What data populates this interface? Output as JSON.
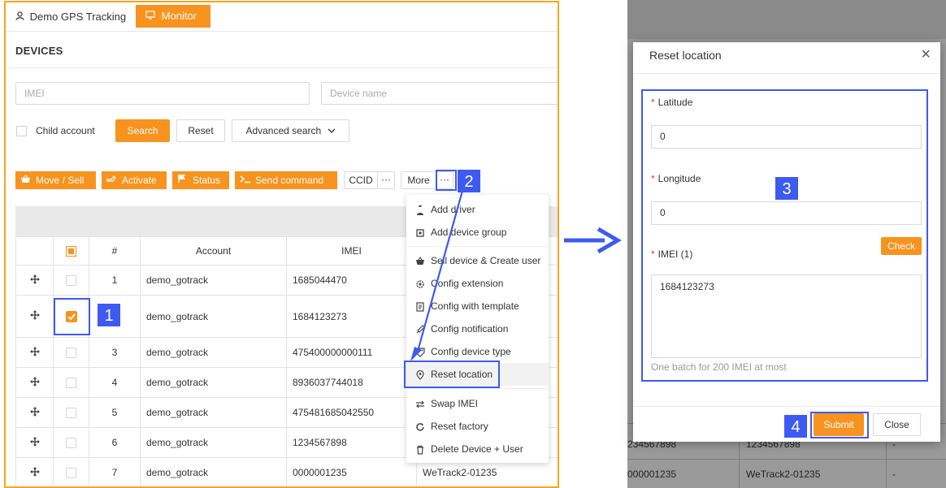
{
  "topbar": {
    "demo_tab": "Demo GPS Tracking",
    "monitor_tab": "Monitor"
  },
  "devices": {
    "title": "DEVICES",
    "imei_placeholder": "IMEI",
    "device_name_placeholder": "Device name",
    "child_account": "Child account",
    "search": "Search",
    "reset": "Reset",
    "advanced_search": "Advanced search",
    "actions": {
      "move_sell": "Move / Sell",
      "activate": "Activate",
      "status": "Status",
      "send_command": "Send command",
      "ccid": "CCID",
      "more": "More",
      "ellipsis": "···"
    },
    "table": {
      "headers": {
        "index": "#",
        "account": "Account",
        "imei": "IMEI"
      },
      "rows": [
        {
          "index": "1",
          "account": "demo_gotrack",
          "imei": "1685044470",
          "checked": false
        },
        {
          "index": "",
          "account": "demo_gotrack",
          "imei": "1684123273",
          "checked": true
        },
        {
          "index": "3",
          "account": "demo_gotrack",
          "imei": "475400000000111",
          "checked": false
        },
        {
          "index": "4",
          "account": "demo_gotrack",
          "imei": "8936037744018",
          "checked": false
        },
        {
          "index": "5",
          "account": "demo_gotrack",
          "imei": "475481685042550",
          "checked": false
        },
        {
          "index": "6",
          "account": "demo_gotrack",
          "imei": "1234567898",
          "checked": false
        },
        {
          "index": "7",
          "account": "demo_gotrack",
          "imei": "0000001235",
          "checked": false
        }
      ],
      "last_row_extra": "WeTrack2-01235"
    }
  },
  "menu": {
    "items": [
      {
        "label": "Add driver",
        "icon": "driver-icon"
      },
      {
        "label": "Add device group",
        "icon": "device-group-icon"
      },
      {
        "label": "Sell device & Create user",
        "icon": "cart-icon"
      },
      {
        "label": "Config extension",
        "icon": "gear-icon"
      },
      {
        "label": "Config with template",
        "icon": "template-icon"
      },
      {
        "label": "Config notification",
        "icon": "rocket-icon"
      },
      {
        "label": "Config device type",
        "icon": "tag-icon"
      },
      {
        "label": "Reset location",
        "icon": "map-pin-icon"
      },
      {
        "label": "Swap IMEI",
        "icon": "swap-icon"
      },
      {
        "label": "Reset factory",
        "icon": "refresh-icon"
      },
      {
        "label": "Delete Device + User",
        "icon": "trash-icon"
      }
    ]
  },
  "annotations": {
    "step1": "1",
    "step2": "2",
    "step3": "3",
    "step4": "4"
  },
  "dialog": {
    "title": "Reset location",
    "close": "×",
    "required_mark": "*",
    "latitude_label": "Latitude",
    "latitude_value": "0",
    "longitude_label": "Longitude",
    "longitude_value": "0",
    "imei_label": "IMEI (1)",
    "check": "Check",
    "imei_value": "1684123273",
    "hint": "One batch for 200 IMEI at most",
    "submit": "Submit",
    "close_button": "Close"
  },
  "background_table": {
    "row_a": [
      "234567898",
      "1234567898",
      "-"
    ],
    "row_b": [
      "000001235",
      "WeTrack2-01235",
      "-"
    ]
  },
  "colors": {
    "accent": "#f7931e",
    "annotation": "#3d5af1",
    "frame": "#f5a623"
  }
}
